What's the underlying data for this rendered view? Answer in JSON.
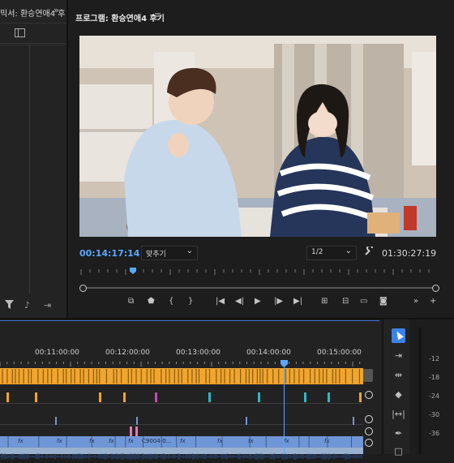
{
  "left_panel": {
    "title": "믹서: 환승연애4 후",
    "expand_glyph": "»",
    "bottom_icons": [
      "filter-icon",
      "audio-icon",
      "export-icon"
    ]
  },
  "program_monitor": {
    "title": "프로그램: 환승연애4 후기",
    "menu_glyph": "≡",
    "timecode_current": "00:14:17:14",
    "fit_select": "맞추기",
    "resolution_select": "1/2",
    "timecode_duration": "01:30:27:19"
  },
  "transport_buttons": [
    "export-frame-icon",
    "marker-icon",
    "in-point-icon",
    "out-point-icon",
    "go-to-in-icon",
    "step-back-icon",
    "play-icon",
    "step-forward-icon",
    "go-to-out-icon",
    "lift-icon",
    "extract-icon",
    "comparison-view-icon",
    "camera-icon",
    "more-icon",
    "add-icon"
  ],
  "timeline": {
    "ruler_labels": [
      "00:11:00:00",
      "00:12:00:00",
      "00:13:00:00",
      "00:14:00:00",
      "00:15:00:00"
    ],
    "clip_label": "C9004-0...",
    "fx_label": "fx"
  },
  "tools": [
    "selection-tool",
    "track-select-tool",
    "ripple-edit-tool",
    "razor-tool",
    "slip-tool",
    "pen-tool",
    "hand-tool"
  ],
  "audio_meter": {
    "labels": [
      "-12",
      "-18",
      "-24",
      "-30",
      "-36"
    ]
  },
  "colors": {
    "accent_blue": "#5ba7ff",
    "marker_orange": "#f0a52e",
    "clip_blue": "#6f96d6",
    "tool_active": "#3b82e8"
  }
}
